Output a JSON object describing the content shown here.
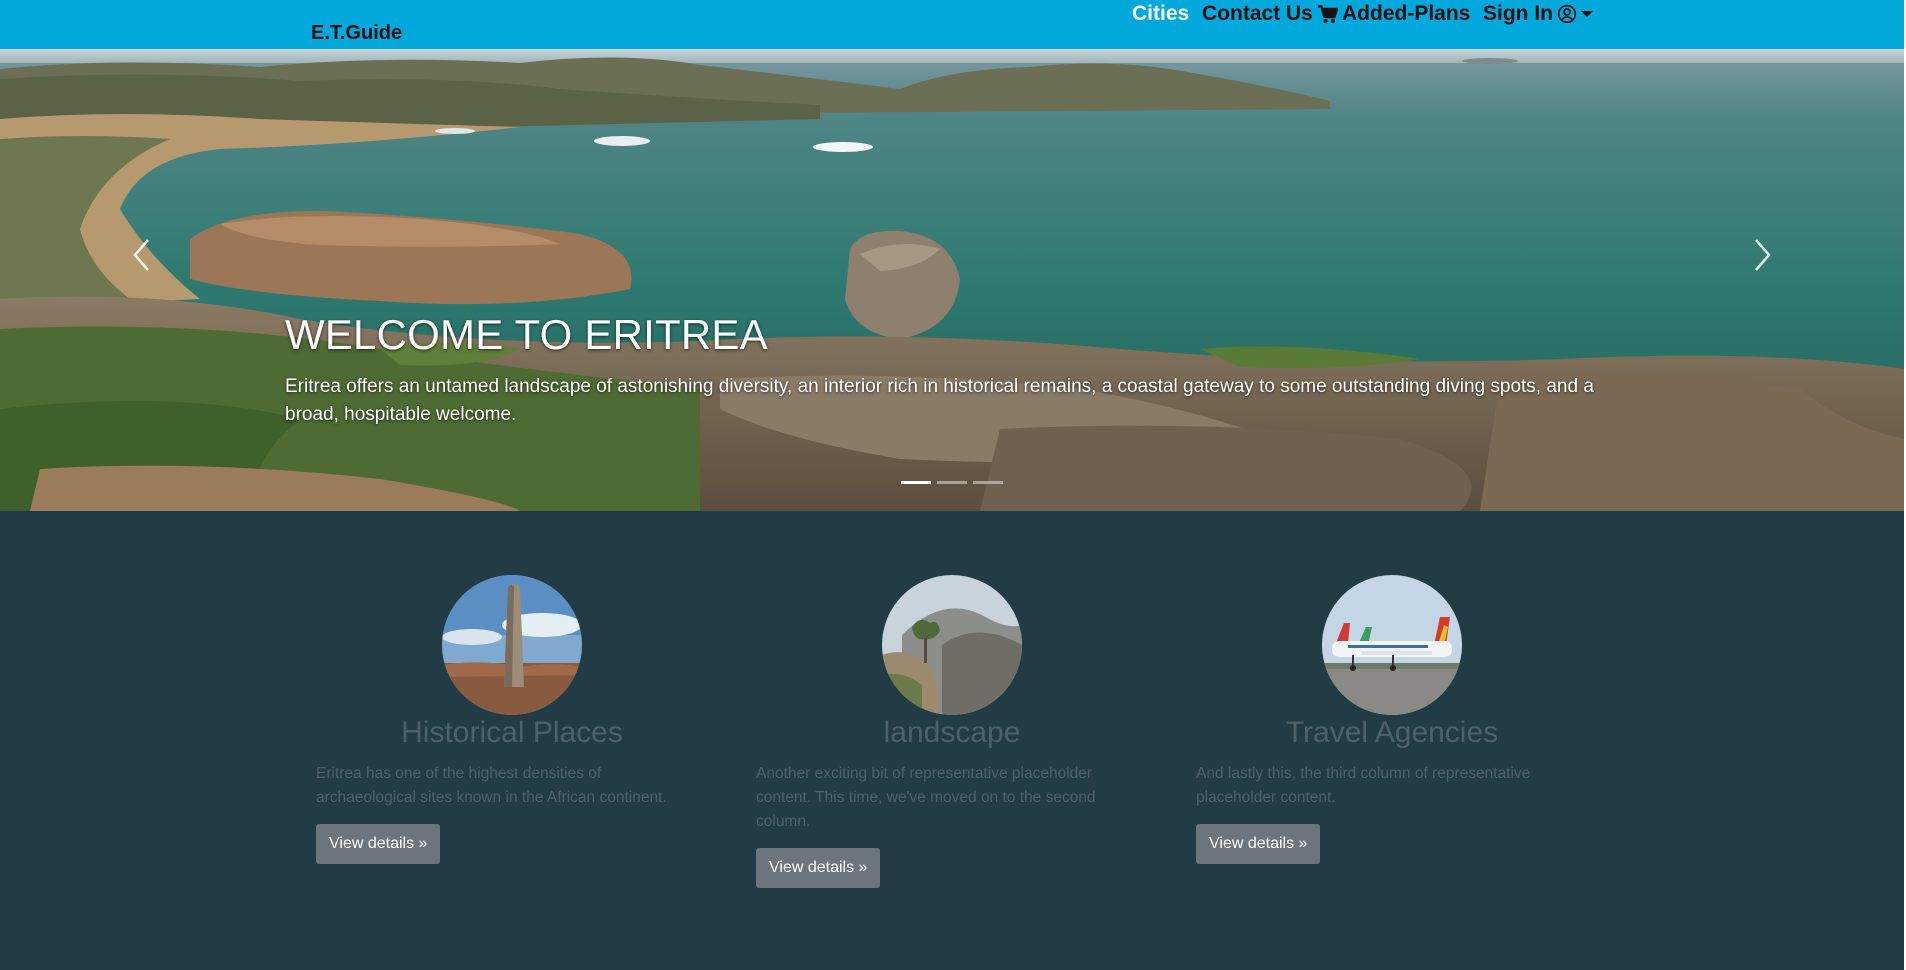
{
  "navbar": {
    "brand": "E.T.Guide",
    "cities": "Cities",
    "contact": "Contact Us",
    "added_plans": "Added-Plans",
    "sign_in": "Sign In",
    "background_color": "#00a8dc",
    "active_color": "#ffffff"
  },
  "carousel": {
    "title": "WELCOME TO ERITREA",
    "text": "Eritrea offers an untamed landscape of astonishing diversity, an interior rich in historical remains, a coastal gateway to some outstanding diving spots, and a broad, hospitable welcome.",
    "slide_count": 3,
    "active_slide": 1
  },
  "features": {
    "background_color": "#223c46",
    "items": [
      {
        "title": "Historical Places",
        "text": "Eritrea has one of the highest densities of archaeological sites known in the African continent.",
        "button": "View details »",
        "image": "obelisk-photo"
      },
      {
        "title": "landscape",
        "text": "Another exciting bit of representative placeholder content. This time, we've moved on to the second column.",
        "button": "View details »",
        "image": "mountain-tree-photo"
      },
      {
        "title": "Travel Agencies",
        "text": "And lastly this, the third column of representative placeholder content.",
        "button": "View details »",
        "image": "airplanes-photo"
      }
    ]
  },
  "icons": {
    "cart": "cart-icon",
    "user": "user-circle-icon",
    "caret": "caret-down-icon",
    "prev": "chevron-left-icon",
    "next": "chevron-right-icon"
  }
}
